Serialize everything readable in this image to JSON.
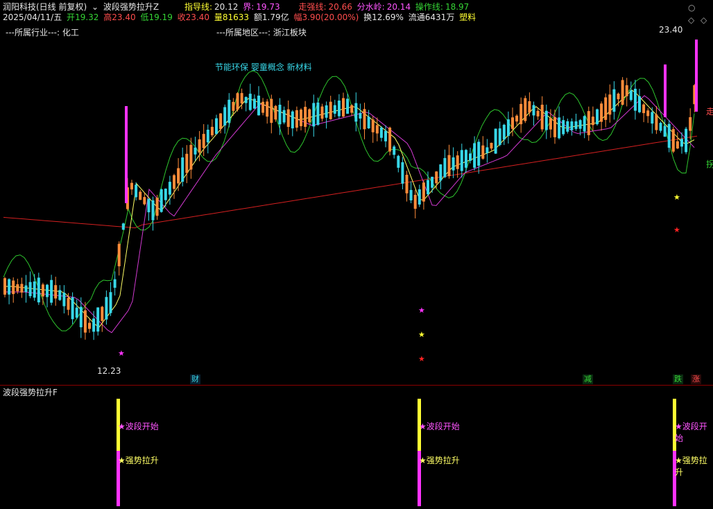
{
  "header": {
    "app_title": "润阳科技(日线 前复权)",
    "indicator_name": "波段强势拉升Z",
    "guide_label": "指导线:",
    "guide_value": "20.12",
    "bound_label": "界:",
    "bound_value": "19.73",
    "strong_label": "走强线:",
    "strong_value": "20.66",
    "divide_label": "分水岭:",
    "divide_value": "20.14",
    "op_label": "操作线:",
    "op_value": "18.97"
  },
  "quote": {
    "date": "2025/04/11/五",
    "open_label": "开",
    "open": "19.32",
    "high_label": "高",
    "high": "23.40",
    "low_label": "低",
    "low": "19.19",
    "close_label": "收",
    "close": "23.40",
    "vol_label": "量",
    "vol": "81633",
    "amt_label": "额",
    "amt": "1.79亿",
    "amp_label": "幅",
    "amp": "3.90(20.00%)",
    "turn_label": "换",
    "turn": "12.69%",
    "float_label": "流通",
    "float": "6431万",
    "sector_tag": "塑料"
  },
  "info": {
    "industry": "---所属行业---: 化工",
    "region": "---所属地区---: 浙江板块",
    "concepts": "节能环保 婴童概念 新材料"
  },
  "labels": {
    "max_price": "23.40",
    "min_price": "12.23",
    "right_top": "走",
    "right_mid": "拐"
  },
  "tags": {
    "cai": "财",
    "jian": "减",
    "die": "跌",
    "zhang": "涨"
  },
  "lower": {
    "title": "波段强势拉升F",
    "wave_start": "★波段开始",
    "strong_rise": "★强势拉升"
  },
  "colors": {
    "up": "#ff8c3a",
    "down": "#38d7e8",
    "ma_long": "#d42020",
    "ma_mid": "#d23ad2",
    "ma_short": "#ffff66",
    "band": "#2ec52e",
    "signal_pink": "#ff33ff",
    "signal_yellow": "#ffff33"
  },
  "icons": {
    "settings": "circle-chevron-icon",
    "diamond": "diamond-icon"
  }
}
